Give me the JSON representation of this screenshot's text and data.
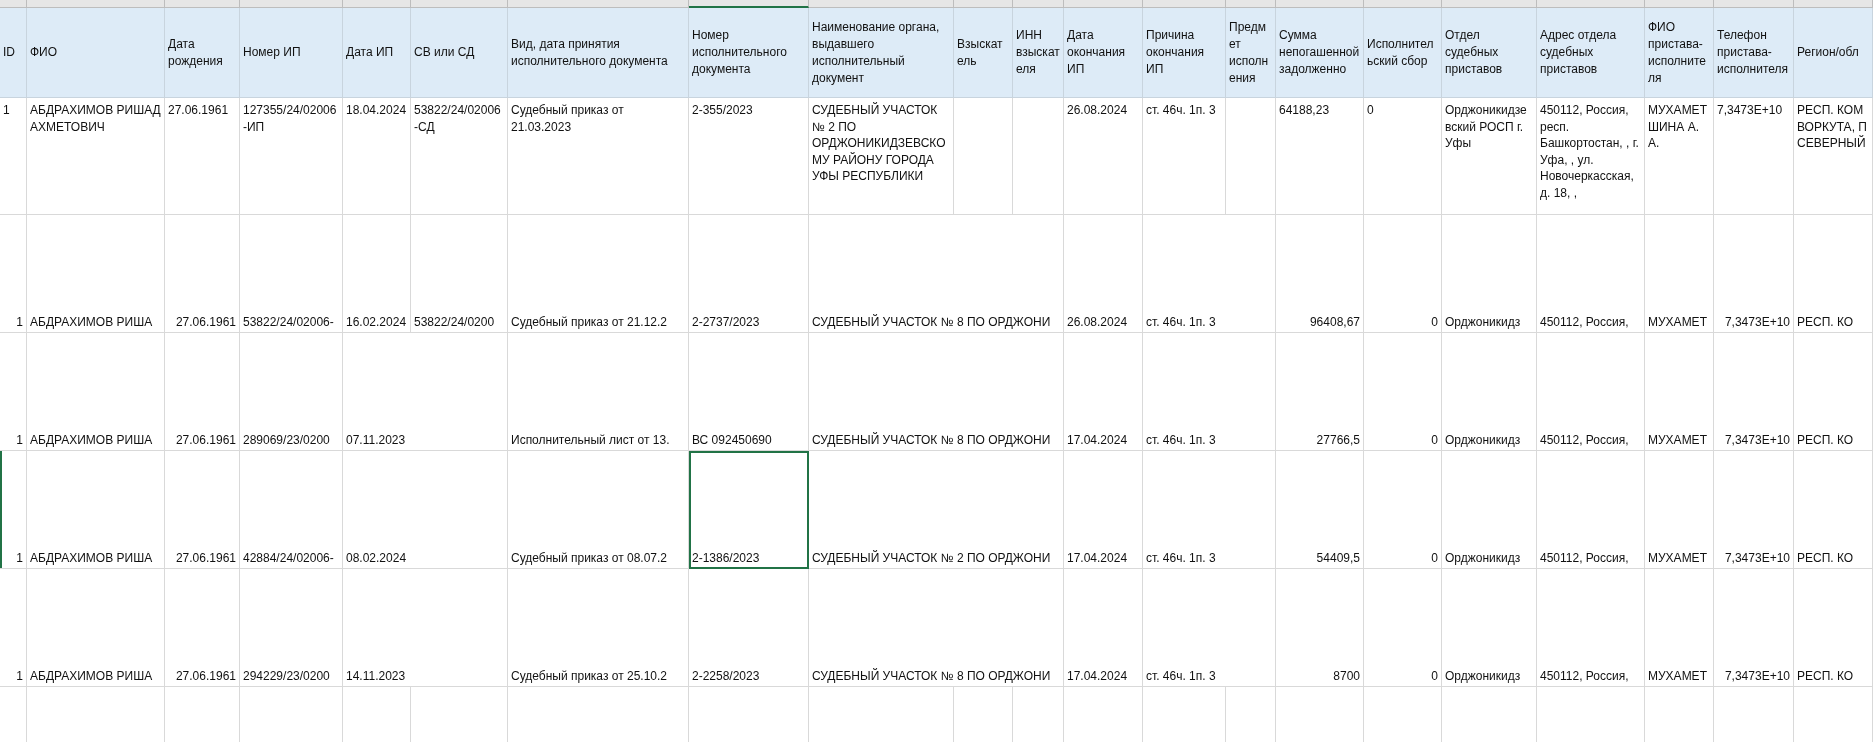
{
  "columns": [
    "ID",
    "ФИО",
    "Дата рождения",
    "Номер ИП",
    "Дата ИП",
    "СВ или СД",
    "Вид, дата принятия исполнительного документа",
    "Номер исполнительного документа",
    "Наименование органа, выдавшего исполнительный документ",
    "Взыскатель",
    "ИНН взыскателя",
    "Дата окончания ИП",
    "Причина окончания ИП",
    "Предмет исполнения",
    "Сумма непогашенной задолженно",
    "Исполнительский сбор",
    "Отдел судебных приставов",
    "Адрес отдела судебных приставов",
    "ФИО пристава-исполнителя",
    "Телефон пристава-исполнителя",
    "Регион/обл"
  ],
  "rows": [
    {
      "wrap": true,
      "cells": [
        "1",
        "АБДРАХИМОВ РИШАД АХМЕТОВИЧ",
        "27.06.1961",
        "127355/24/02006-ИП",
        "18.04.2024",
        "53822/24/02006-СД",
        "Судебный приказ от 21.03.2023",
        "2-355/2023",
        "СУДЕБНЫЙ УЧАСТОК № 2 ПО ОРДЖОНИКИДЗЕВСКОМУ РАЙОНУ ГОРОДА УФЫ РЕСПУБЛИКИ",
        null,
        null,
        "26.08.2024",
        "ст. 46ч. 1п. 3",
        null,
        "64188,23",
        "0",
        "Орджоникидзевский РОСП г. Уфы",
        "450112, Россия, респ. Башкортостан, , г. Уфа, , ул. Новочеркасская, д. 18, ,",
        "МУХАМЕТШИНА А. А.",
        "7,3473E+10",
        "РЕСП. КОМ ВОРКУТА, П СЕВЕРНЫЙ"
      ]
    },
    {
      "wrap": false,
      "cells": [
        {
          "text": "1",
          "kind": "number"
        },
        "АБДРАХИМОВ РИША",
        {
          "text": "27.06.1961",
          "kind": "number"
        },
        "53822/24/02006-",
        "16.02.2024",
        "53822/24/0200",
        "Судебный приказ от 21.12.2",
        "2-2737/2023",
        "СУДЕБНЫЙ УЧАСТОК № 8 ПО ОРДЖОНИ",
        null,
        null,
        "26.08.2024",
        "ст. 46ч. 1п. 3",
        null,
        {
          "text": "96408,67",
          "kind": "number"
        },
        {
          "text": "0",
          "kind": "number"
        },
        "Орджоникидз",
        "450112, Россия,",
        "МУХАМЕТ",
        {
          "text": "7,3473E+10",
          "kind": "number"
        },
        "РЕСП. КО"
      ]
    },
    {
      "wrap": false,
      "cells": [
        {
          "text": "1",
          "kind": "number"
        },
        "АБДРАХИМОВ РИША",
        {
          "text": "27.06.1961",
          "kind": "number"
        },
        "289069/23/0200",
        "07.11.2023",
        null,
        "Исполнительный лист от 13.",
        "ВС 092450690",
        "СУДЕБНЫЙ УЧАСТОК № 8 ПО ОРДЖОНИ",
        null,
        null,
        "17.04.2024",
        "ст. 46ч. 1п. 3",
        null,
        {
          "text": "27766,5",
          "kind": "number"
        },
        {
          "text": "0",
          "kind": "number"
        },
        "Орджоникидз",
        "450112, Россия,",
        "МУХАМЕТ",
        {
          "text": "7,3473E+10",
          "kind": "number"
        },
        "РЕСП. КО"
      ]
    },
    {
      "wrap": false,
      "cells": [
        {
          "text": "1",
          "kind": "number"
        },
        "АБДРАХИМОВ РИША",
        {
          "text": "27.06.1961",
          "kind": "number"
        },
        "42884/24/02006-",
        "08.02.2024",
        null,
        "Судебный приказ от 08.07.2",
        {
          "text": "2-1386/2023",
          "selected": true
        },
        "СУДЕБНЫЙ УЧАСТОК № 2 ПО ОРДЖОНИ",
        null,
        null,
        "17.04.2024",
        "ст. 46ч. 1п. 3",
        null,
        {
          "text": "54409,5",
          "kind": "number"
        },
        {
          "text": "0",
          "kind": "number"
        },
        "Орджоникидз",
        "450112, Россия,",
        "МУХАМЕТ",
        {
          "text": "7,3473E+10",
          "kind": "number"
        },
        "РЕСП. КО"
      ]
    },
    {
      "wrap": false,
      "cells": [
        {
          "text": "1",
          "kind": "number"
        },
        "АБДРАХИМОВ РИША",
        {
          "text": "27.06.1961",
          "kind": "number"
        },
        "294229/23/0200",
        "14.11.2023",
        null,
        "Судебный приказ от 25.10.2",
        "2-2258/2023",
        "СУДЕБНЫЙ УЧАСТОК № 8 ПО ОРДЖОНИ",
        null,
        null,
        "17.04.2024",
        "ст. 46ч. 1п. 3",
        null,
        {
          "text": "8700",
          "kind": "number"
        },
        {
          "text": "0",
          "kind": "number"
        },
        "Орджоникидз",
        "450112, Россия,",
        "МУХАМЕТ",
        {
          "text": "7,3473E+10",
          "kind": "number"
        },
        "РЕСП. КО"
      ]
    }
  ]
}
